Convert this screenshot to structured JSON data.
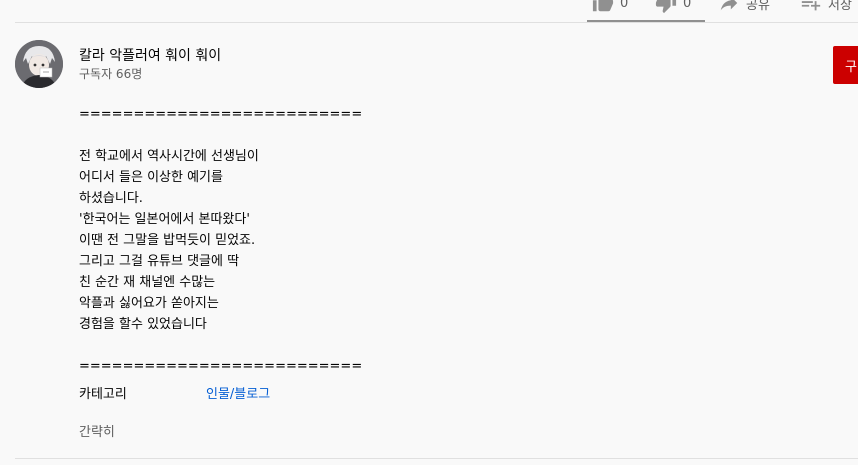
{
  "actions": {
    "like_count": "0",
    "dislike_count": "0",
    "share_label": "공유",
    "save_label": "저장"
  },
  "channel": {
    "name": "칼라 악플러여 훠이 훠이",
    "subscribers": "구독자 66명",
    "subscribe_label": "구"
  },
  "description": {
    "lines": [
      "==========================",
      "",
      "전 학교에서 역사시간에 선생님이",
      "어디서 들은 이상한 예기를",
      "하셨습니다.",
      "'한국어는 일본어에서 본따왔다'",
      "이땐 전 그말을 밥먹듯이 믿었죠.",
      "그리고 그걸 유튜브 댓글에 딱",
      "친 순간 재 채널엔 수많는",
      "악플과 싫어요가 쏟아지는",
      "경험을 할수 있었습니다",
      "",
      "=========================="
    ]
  },
  "category": {
    "label": "카테고리",
    "value": "인물/블로그"
  },
  "show_less": "간략히"
}
